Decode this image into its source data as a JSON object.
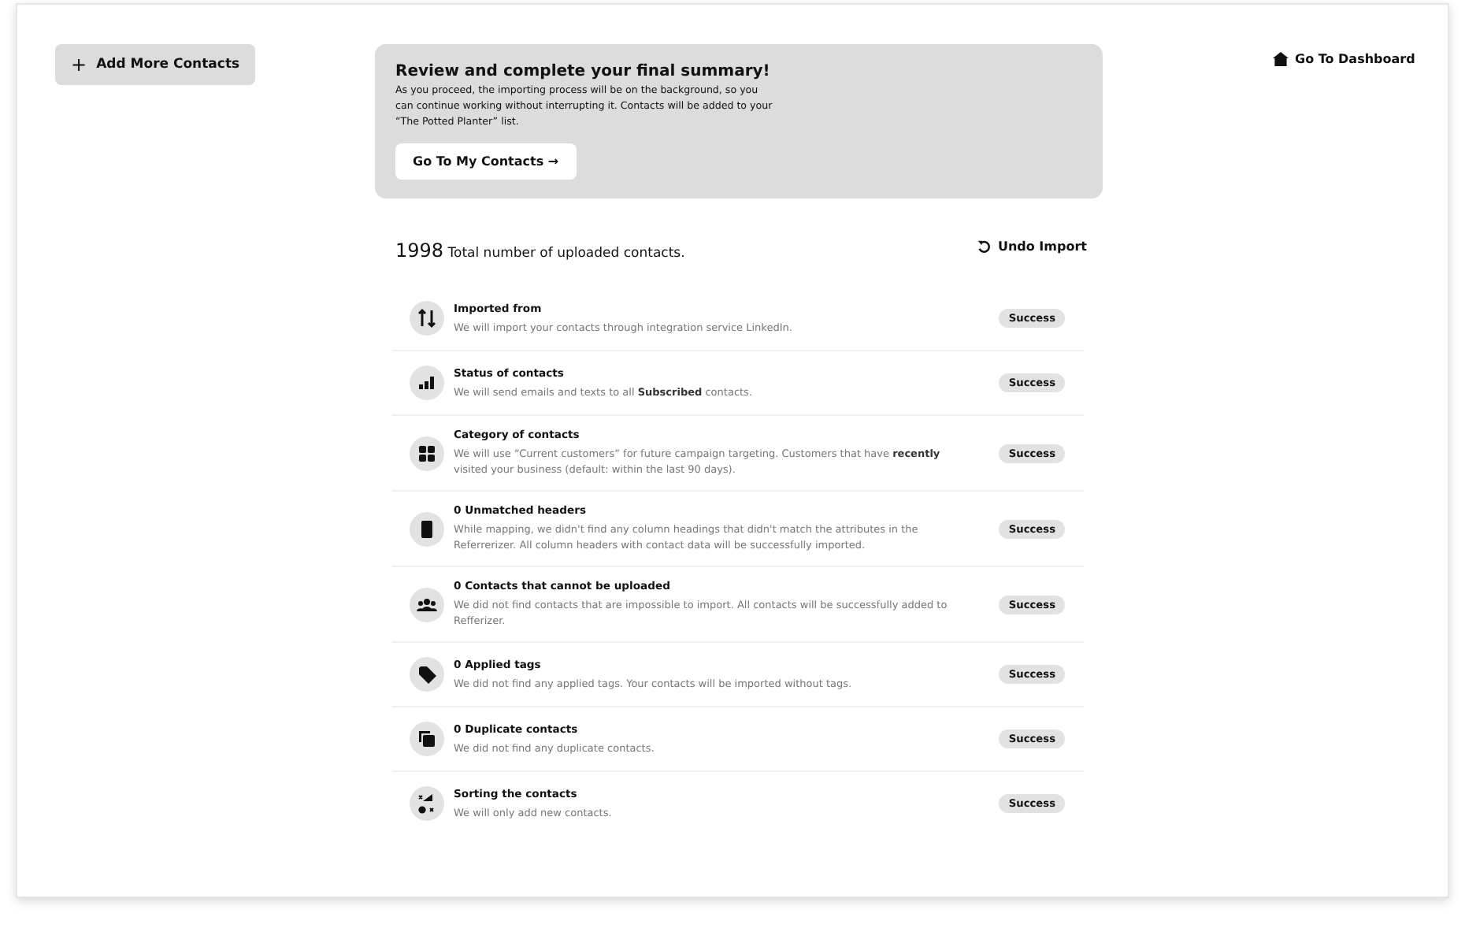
{
  "add_button": {
    "icon": "+",
    "label": "Add More Contacts"
  },
  "banner": {
    "title": "Review and complete your final summary!",
    "text": "As you proceed, the importing process will be on the background, so you can continue working without interrupting it. Contacts will be added to your “The Potted Planter” list.",
    "button": "Go To My Contacts →"
  },
  "dashboard_link": "Go To Dashboard",
  "summary": {
    "count": "1998",
    "label": "Total number of uploaded contacts."
  },
  "undo_button": "Undo Import",
  "items": [
    {
      "title": "Imported from",
      "text": "We will import your contacts through integration service LinkedIn.",
      "status": "Success"
    },
    {
      "title": "Status of contacts",
      "text": "We will send emails and texts to all **Subscribed** contacts.",
      "status": "Success"
    },
    {
      "title": "Category of contacts",
      "text": "We will use “Current customers” for future campaign targeting. Customers that have **recently** visited your business (default: within the last 90 days).",
      "status": "Success"
    },
    {
      "title": "0 Unmatched headers",
      "text": "While mapping, we didn't find any column headings that didn't match the attributes in the Referrerizer. All column headers with contact data will be successfully imported.",
      "status": "Success"
    },
    {
      "title": "0 Contacts that cannot be uploaded",
      "text": "We did not find contacts that are impossible to import. All contacts will be successfully added to Refferizer.",
      "status": "Success"
    },
    {
      "title": "0 Applied tags",
      "text": "We did not find any applied tags. Your contacts will be imported without tags.",
      "status": "Success"
    },
    {
      "title": "0 Duplicate contacts",
      "text": "We did not find any duplicate contacts.",
      "status": "Success"
    },
    {
      "title": "Sorting the contacts",
      "text": "We will only add new contacts.",
      "status": "Success"
    }
  ]
}
